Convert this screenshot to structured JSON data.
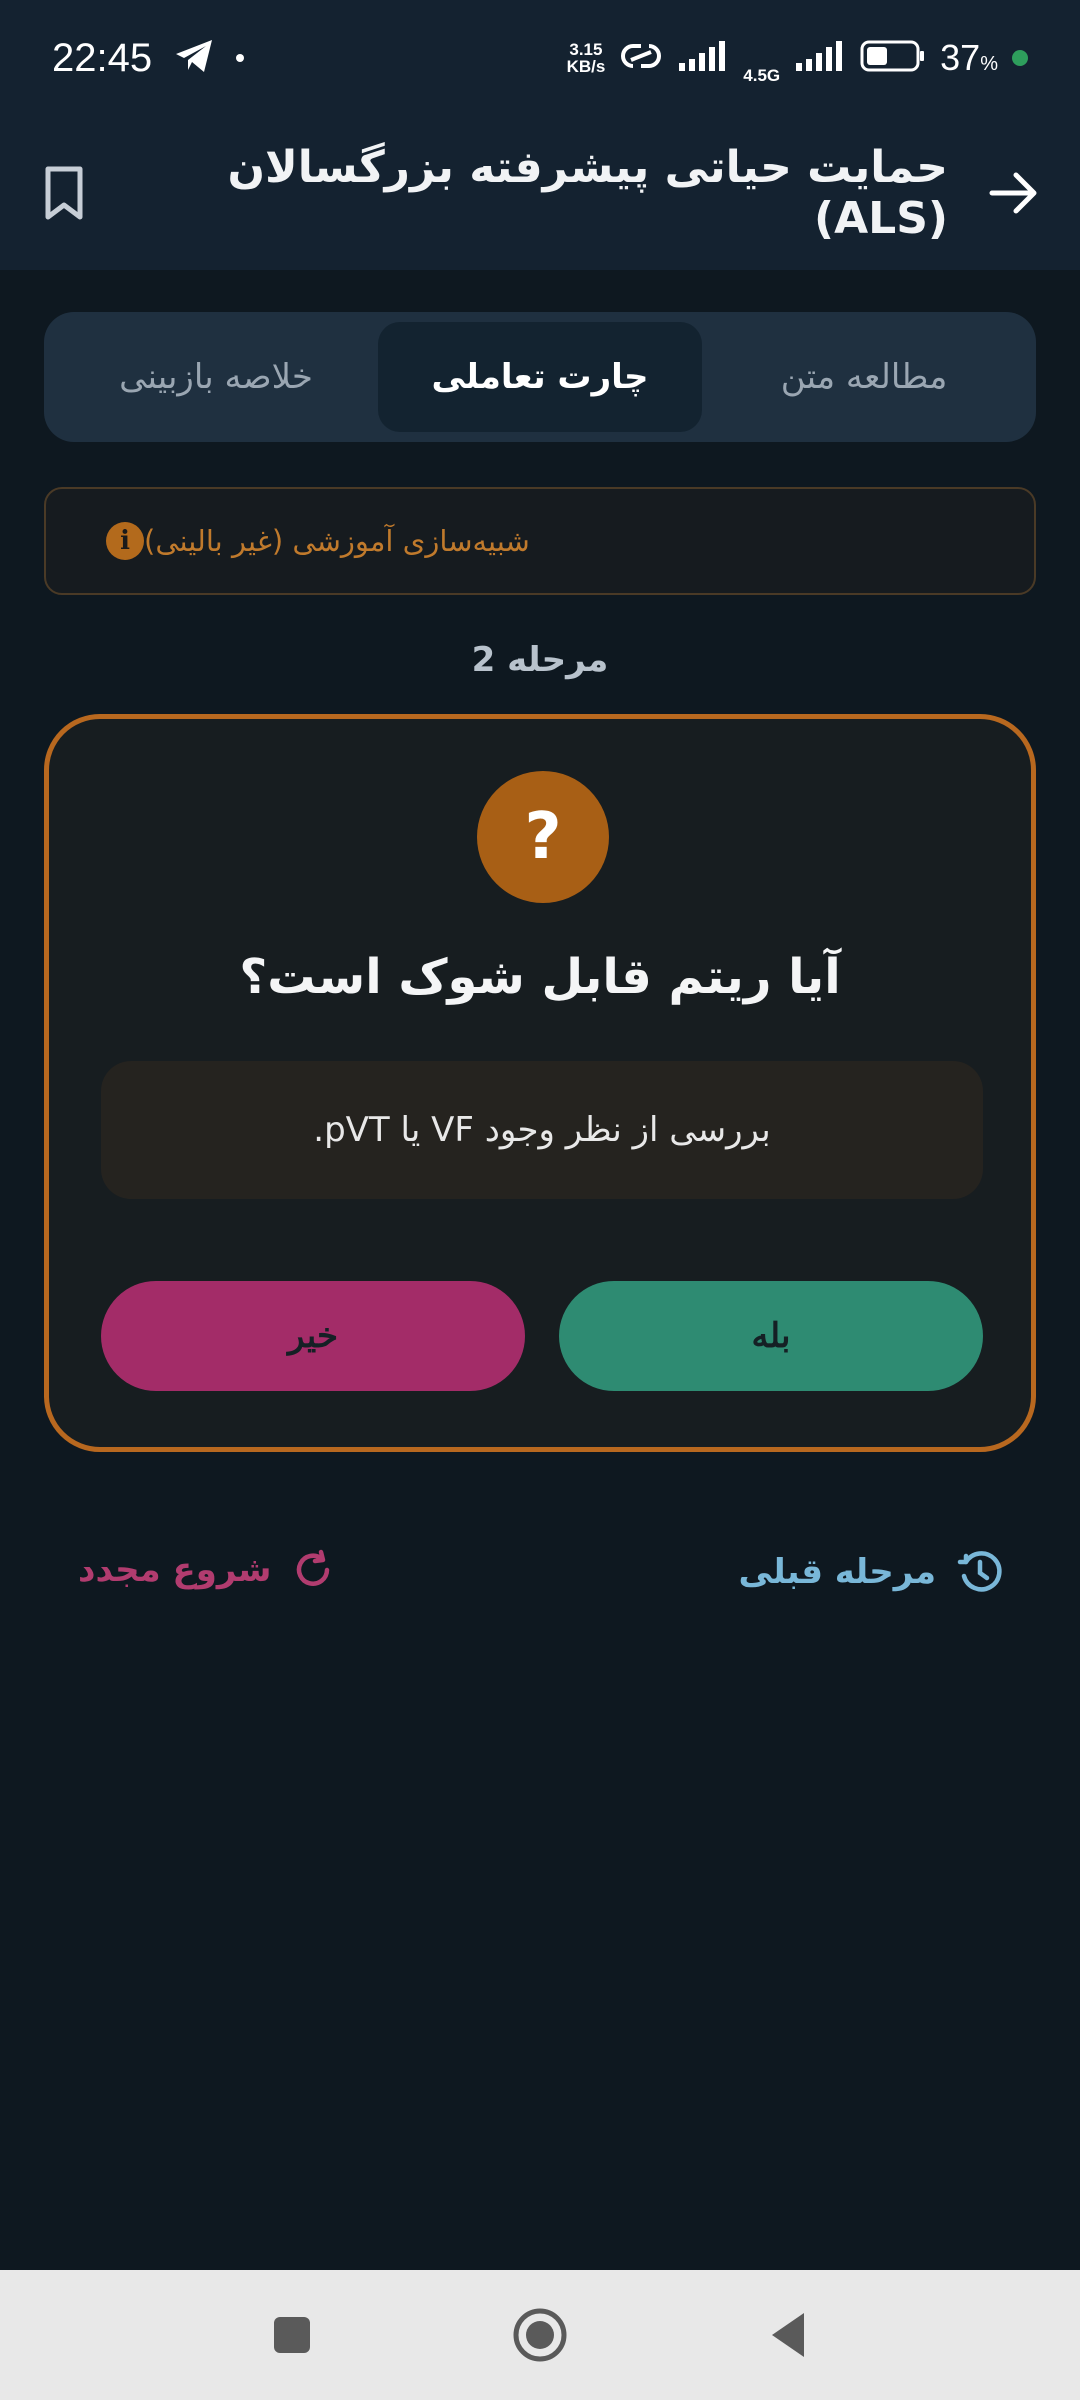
{
  "status": {
    "time": "22:45",
    "net_speed_value": "3.15",
    "net_speed_unit": "KB/s",
    "net_type": "4.5G",
    "battery": "37",
    "battery_unit": "%"
  },
  "header": {
    "title": "حمایت حیاتی پیشرفته بزرگسالان (ALS)"
  },
  "tabs": [
    {
      "label": "مطالعه متن",
      "active": false
    },
    {
      "label": "چارت تعاملی",
      "active": true
    },
    {
      "label": "خلاصه بازبینی",
      "active": false
    }
  ],
  "notice": {
    "text": "شبیه‌سازی آموزشی (غیر بالینی)"
  },
  "step": {
    "label": "مرحله 2"
  },
  "question": {
    "icon_symbol": "?",
    "title": "آیا ریتم قابل شوک است؟",
    "hint": "بررسی از نظر وجود VF یا pVT.",
    "yes_label": "بله",
    "no_label": "خیر"
  },
  "actions": {
    "previous_label": "مرحله قبلی",
    "restart_label": "شروع مجدد"
  },
  "colors": {
    "accent": "#b8681f",
    "yes": "#2e8b72",
    "no": "#a32c68",
    "link_blue": "#79b7d8",
    "link_pink": "#b13c6f"
  }
}
